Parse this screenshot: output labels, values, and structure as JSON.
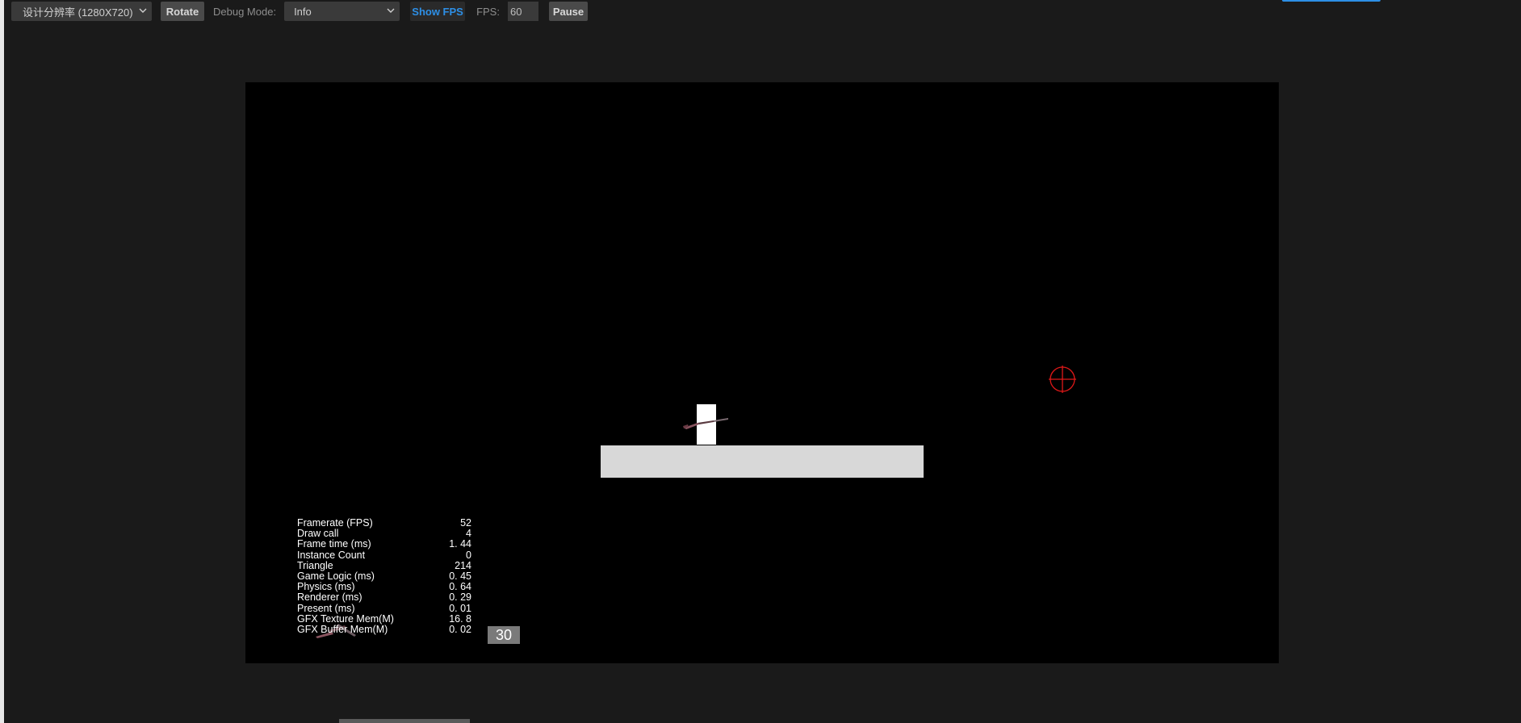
{
  "toolbar": {
    "resolution": "设计分辨率 (1280X720)",
    "rotate": "Rotate",
    "debug_label": "Debug Mode:",
    "debug_value": "Info",
    "show_fps": "Show FPS",
    "fps_label": "FPS:",
    "fps_value": "60",
    "pause": "Pause"
  },
  "stats": [
    {
      "label": "Framerate (FPS)",
      "value": "52"
    },
    {
      "label": "Draw call",
      "value": "4"
    },
    {
      "label": "Frame time (ms)",
      "value": "1. 44"
    },
    {
      "label": "Instance Count",
      "value": "0"
    },
    {
      "label": "Triangle",
      "value": "214"
    },
    {
      "label": "Game Logic (ms)",
      "value": "0. 45"
    },
    {
      "label": "Physics (ms)",
      "value": "0. 64"
    },
    {
      "label": "Renderer (ms)",
      "value": "0. 29"
    },
    {
      "label": "Present (ms)",
      "value": "0. 01"
    },
    {
      "label": "GFX Texture Mem(M)",
      "value": "16. 8"
    },
    {
      "label": "GFX Buffer Mem(M)",
      "value": "0. 02"
    }
  ],
  "counter": "30",
  "colors": {
    "accent": "#2d8fe6",
    "crosshair": "#e01818",
    "canvas_bg": "#000000",
    "platform": "#d8d8d8"
  },
  "icons": [
    "chevron-down-icon",
    "crosshair-icon",
    "gun-icon"
  ]
}
